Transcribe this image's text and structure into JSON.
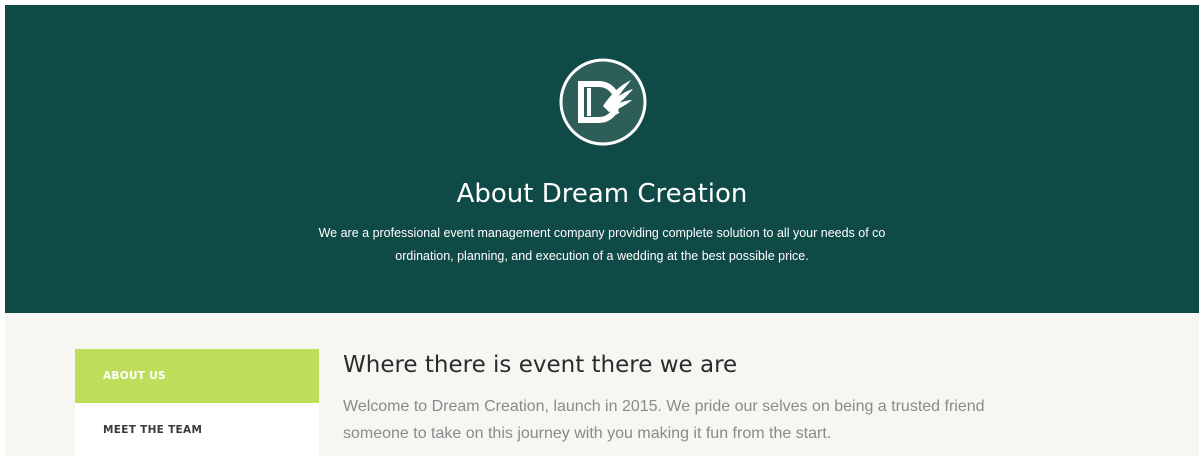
{
  "hero": {
    "logo_icon": "dream-creation-logo",
    "title": "About Dream Creation",
    "description_line1": "We are a professional event management company providing complete solution to all your needs of co",
    "description_line2": "ordination, planning, and execution of a wedding at the best possible price."
  },
  "sidebar": {
    "items": [
      {
        "label": "ABOUT US",
        "active": true
      },
      {
        "label": "MEET THE TEAM",
        "active": false
      }
    ]
  },
  "main": {
    "heading": "Where there is event there we are",
    "text_line1": "Welcome to Dream Creation, launch in 2015. We pride our selves on being a trusted friend",
    "text_line2": "someone to take on this journey with you making it fun from the start."
  },
  "colors": {
    "hero_bg": "#104a47",
    "logo_bg": "#2d5e57",
    "active_nav": "#bedd5a",
    "content_bg": "#f8f6f3"
  }
}
